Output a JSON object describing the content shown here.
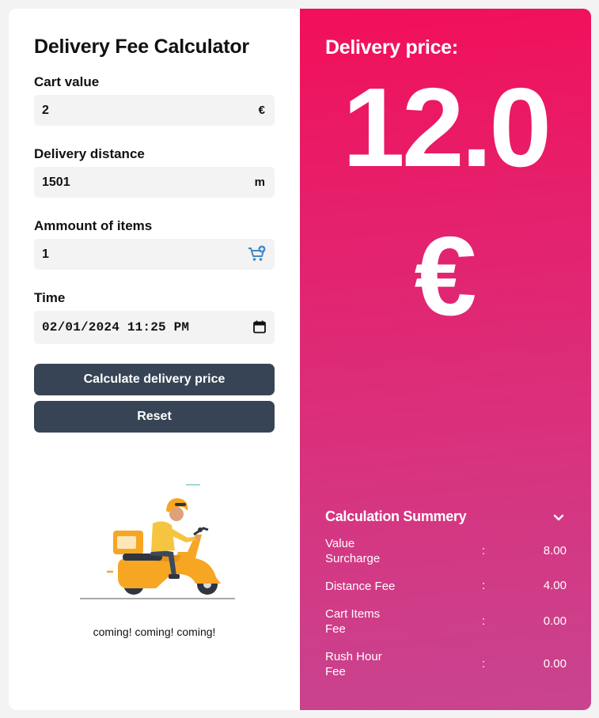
{
  "form": {
    "title": "Delivery Fee Calculator",
    "cart_value": {
      "label": "Cart value",
      "value": "2",
      "unit": "€"
    },
    "delivery_distance": {
      "label": "Delivery distance",
      "value": "1501",
      "unit": "m"
    },
    "items": {
      "label": "Ammount of items",
      "value": "1",
      "icon": "cart-plus-icon"
    },
    "time": {
      "label": "Time",
      "value": "02/01/2024 11:25 PM",
      "icon": "calendar-icon"
    },
    "calculate_label": "Calculate delivery price",
    "reset_label": "Reset",
    "caption": "coming! coming! coming!"
  },
  "result": {
    "label": "Delivery price:",
    "amount": "12.0",
    "currency": "€",
    "summary_title": "Calculation Summery",
    "summary_icon": "chevron-down-icon",
    "rows": [
      {
        "label": "Value Surcharge",
        "sep": ":",
        "value": "8.00"
      },
      {
        "label": "Distance Fee",
        "sep": ":",
        "value": "4.00"
      },
      {
        "label": "Cart Items Fee",
        "sep": ":",
        "value": "0.00"
      },
      {
        "label": "Rush Hour Fee",
        "sep": ":",
        "value": "0.00"
      }
    ]
  },
  "colors": {
    "gradient_top": "#f20f5a",
    "gradient_bottom": "#c8448f",
    "button": "#374455",
    "field_bg": "#f3f3f3",
    "scooter_yellow": "#f6a623"
  }
}
